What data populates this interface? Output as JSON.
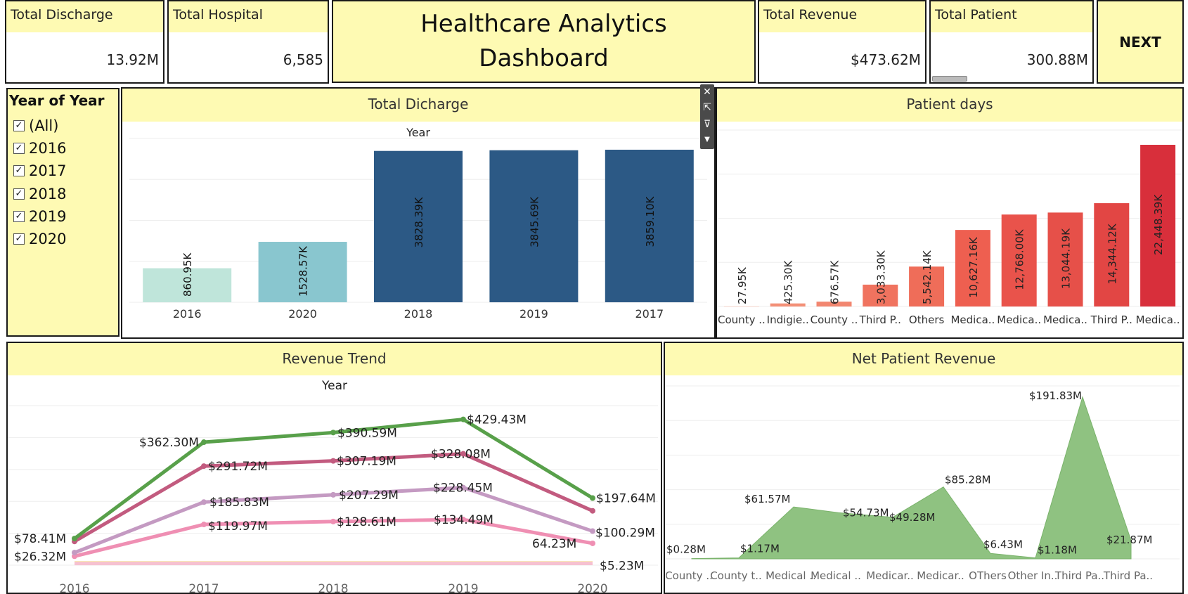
{
  "dashboard": {
    "title_line1": "Healthcare Analytics",
    "title_line2": "Dashboard",
    "next_label": "NEXT"
  },
  "kpis": {
    "total_discharge": {
      "label": "Total Discharge",
      "value": "13.92M"
    },
    "total_hospital": {
      "label": "Total Hospital",
      "value": "6,585"
    },
    "total_revenue": {
      "label": "Total Revenue",
      "value": "$473.62M"
    },
    "total_patient": {
      "label": "Total Patient",
      "value": "300.88M"
    }
  },
  "filter": {
    "title": "Year of Year",
    "items": [
      {
        "label": "(All)",
        "checked": true
      },
      {
        "label": "2016",
        "checked": true
      },
      {
        "label": "2017",
        "checked": true
      },
      {
        "label": "2018",
        "checked": true
      },
      {
        "label": "2019",
        "checked": true
      },
      {
        "label": "2020",
        "checked": true
      }
    ]
  },
  "toolbar": {
    "icons": [
      "close-icon",
      "popout-icon",
      "filter-icon",
      "dropdown-icon"
    ]
  },
  "chart_data": [
    {
      "id": "discharge",
      "type": "bar",
      "title": "Total Dicharge",
      "xlabel": "Year",
      "categories": [
        "2016",
        "2020",
        "2018",
        "2019",
        "2017"
      ],
      "values": [
        860.95,
        1528.57,
        3828.39,
        3845.69,
        3859.1
      ],
      "value_labels": [
        "860.95K",
        "1528.57K",
        "3828.39K",
        "3845.69K",
        "3859.10K"
      ],
      "colors": [
        "#bfe5da",
        "#89c6cf",
        "#2c5985",
        "#2c5985",
        "#2c5985"
      ],
      "ylim": [
        0,
        4250
      ],
      "grid": true
    },
    {
      "id": "patient_days",
      "type": "bar",
      "title": "Patient days",
      "categories": [
        "County ..",
        "Indigie..",
        "County ..",
        "Third P..",
        "Others",
        "Medica..",
        "Medica..",
        "Medica..",
        "Third P..",
        "Medica.."
      ],
      "values": [
        27.95,
        425.3,
        676.57,
        3033.3,
        5542.14,
        10627.16,
        12768.0,
        13044.19,
        14344.12,
        22448.39
      ],
      "value_labels": [
        "27.95K",
        "425.30K",
        "676.57K",
        "3,033.30K",
        "5,542.14K",
        "10,627.16K",
        "12,768.00K",
        "13,044.19K",
        "14,344.12K",
        "22,448.39K"
      ],
      "colors": [
        "#f7b9a5",
        "#f39077",
        "#f28670",
        "#f0735f",
        "#ef6d59",
        "#ee5f50",
        "#e9534b",
        "#e65049",
        "#e24644",
        "#d82f3b"
      ],
      "ylim": [
        0,
        24500
      ],
      "grid": true
    },
    {
      "id": "revenue_trend",
      "type": "line",
      "title": "Revenue Trend",
      "xlabel": "Year",
      "x": [
        "2016",
        "2017",
        "2018",
        "2019",
        "2020"
      ],
      "ylim": [
        0,
        470
      ],
      "grid": true,
      "series": [
        {
          "color": "#58a04a",
          "values": [
            78.41,
            362.3,
            390.59,
            429.43,
            197.64
          ],
          "labels": [
            "$78.41M",
            "$362.30M",
            "$390.59M",
            "$429.43M",
            "$197.64M"
          ]
        },
        {
          "color": "#c25b7f",
          "values": [
            70,
            291.72,
            307.19,
            328.08,
            160
          ],
          "labels": [
            "",
            "$291.72M",
            "$307.19M",
            "$328.08M",
            ""
          ]
        },
        {
          "color": "#c49ac2",
          "values": [
            37,
            185.83,
            207.29,
            228.45,
            100.29
          ],
          "labels": [
            "",
            "$185.83M",
            "$207.29M",
            "$228.45M",
            "$100.29M"
          ]
        },
        {
          "color": "#ef8fb3",
          "values": [
            26.32,
            119.97,
            128.61,
            134.49,
            64.23
          ],
          "labels": [
            "$26.32M",
            "$119.97M",
            "$128.61M",
            "$134.49M",
            "64.23M"
          ]
        },
        {
          "color": "#f6c1d1",
          "values": [
            5,
            5.2,
            5.2,
            5.23,
            5.23
          ],
          "labels": [
            "",
            "",
            "",
            "",
            "$5.23M"
          ]
        },
        {
          "color": "#f3dc8c",
          "values": [
            6.5,
            6.5,
            6.5,
            6.5,
            6.5
          ],
          "labels": [
            "",
            "",
            "",
            "",
            ""
          ]
        }
      ]
    },
    {
      "id": "net_patient_revenue",
      "type": "area",
      "title": "Net Patient Revenue",
      "categories": [
        "County ..",
        "County t..",
        "Medical ..",
        "Medical ..",
        "Medicar..",
        "Medicar..",
        "OThers",
        "Other In..",
        "Third Pa..",
        "Third Pa.."
      ],
      "values": [
        0.28,
        1.17,
        61.57,
        54.73,
        49.28,
        85.28,
        6.43,
        1.18,
        191.83,
        21.87
      ],
      "value_labels": [
        "$0.28M",
        "$1.17M",
        "$61.57M",
        "$54.73M",
        "$49.28M",
        "$85.28M",
        "$6.43M",
        "$1.18M",
        "$191.83M",
        "$21.87M"
      ],
      "color": "#8fc281",
      "ylim": [
        0,
        205
      ],
      "grid": true
    }
  ]
}
